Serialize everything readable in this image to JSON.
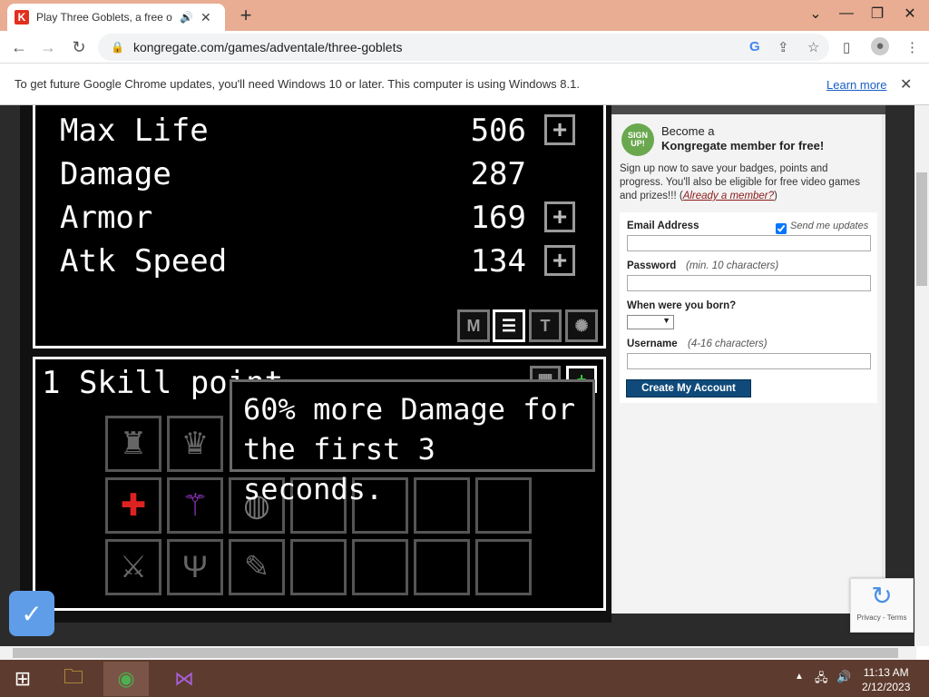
{
  "browser": {
    "tab_title": "Play Three Goblets, a free on",
    "tab_favicon": "K",
    "url": "kongregate.com/games/adventale/three-goblets",
    "accent": "#e8ad93"
  },
  "infobar": {
    "message": "To get future Google Chrome updates, you'll need Windows 10 or later. This computer is using Windows 8.1.",
    "link": "Learn more"
  },
  "game": {
    "stats": [
      {
        "name": "Max Life",
        "value": "506"
      },
      {
        "name": "Damage",
        "value": "287"
      },
      {
        "name": "Armor",
        "value": "169"
      },
      {
        "name": "Atk Speed",
        "value": "134"
      }
    ],
    "skill_points": "1 Skill point",
    "tooltip_line1": "60% more Damage for",
    "tooltip_line2": "the first 3 seconds."
  },
  "signup": {
    "badge": "SIGN UP!",
    "become_line1": "Become a",
    "become_line2": "Kongregate member for free!",
    "text": "Sign up now to save your badges, points and progress. You'll also be eligible for free video games and prizes!!!",
    "already": "Already a member?",
    "email_label": "Email Address",
    "send_updates": "Send me updates",
    "password_label": "Password",
    "password_note": "(min. 10 characters)",
    "born_label": "When were you born?",
    "username_label": "Username",
    "username_note": "(4-16 characters)",
    "create_button": "Create My Account"
  },
  "recaptcha": {
    "text": "Privacy - Terms"
  },
  "taskbar": {
    "time": "11:13 AM",
    "date": "2/12/2023"
  }
}
